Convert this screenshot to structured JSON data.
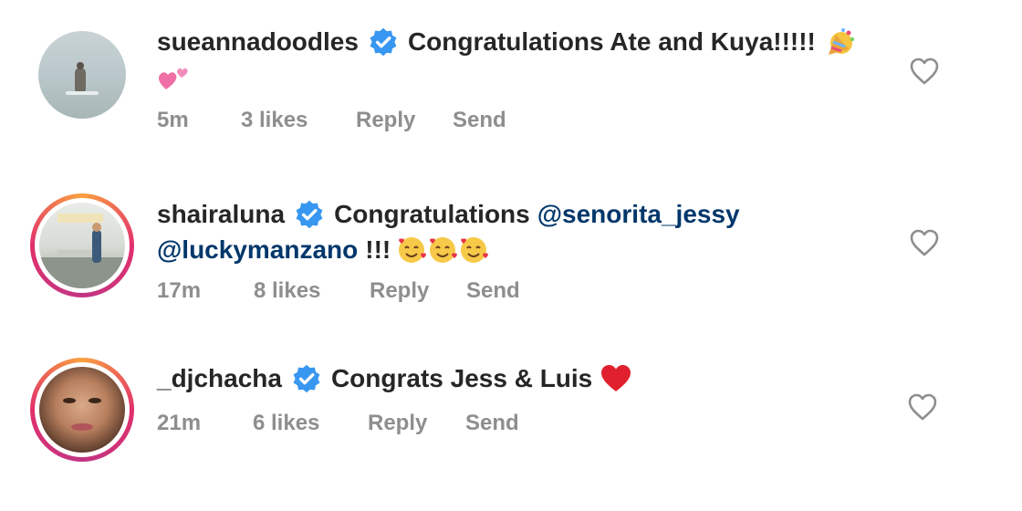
{
  "comments": [
    {
      "username": "sueannadoodles",
      "text": "Congratulations Ate and Kuya!!!!!",
      "time": "5m",
      "likes": "3 likes",
      "reply": "Reply",
      "send": "Send"
    },
    {
      "username": "shairaluna",
      "text": "Congratulations",
      "mention1": "@senorita_jessy",
      "mention2": "@luckymanzano",
      "text2": "!!!",
      "time": "17m",
      "likes": "8 likes",
      "reply": "Reply",
      "send": "Send"
    },
    {
      "username": "_djchacha",
      "text": "Congrats Jess & Luis",
      "time": "21m",
      "likes": "6 likes",
      "reply": "Reply",
      "send": "Send"
    }
  ],
  "icons": {
    "verified": "verified-badge-icon",
    "like": "heart-outline-icon",
    "party": "party-popper-emoji",
    "hearts": "two-hearts-emoji",
    "smiling_hearts": "smiling-face-with-hearts-emoji",
    "red_heart": "red-heart-emoji"
  },
  "colors": {
    "text": "#262626",
    "secondary": "#8e8e8e",
    "mention": "#00376b",
    "verified": "#3897f0"
  }
}
